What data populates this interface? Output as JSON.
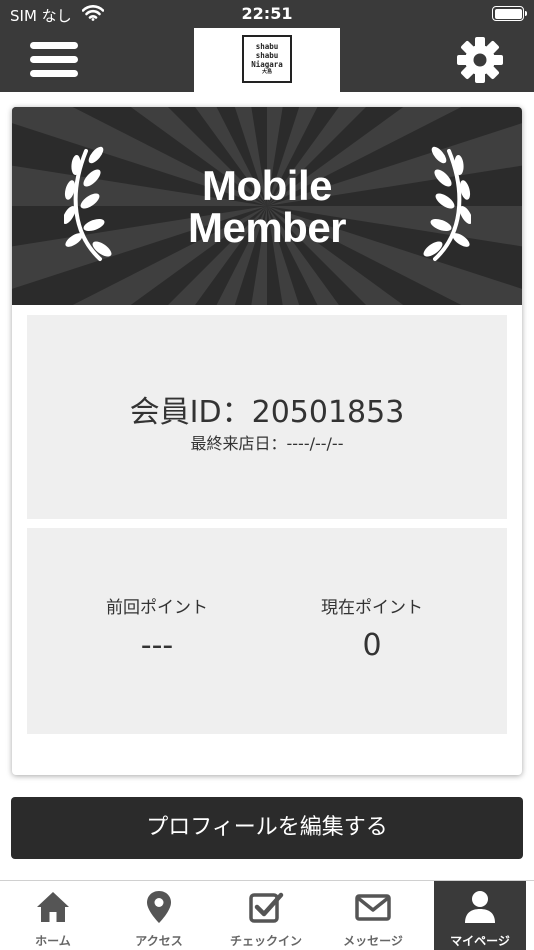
{
  "status_bar": {
    "carrier": "SIM なし",
    "time": "22:51"
  },
  "header": {
    "logo_lines": [
      "shabu",
      "shabu",
      "Niagara"
    ],
    "logo_sub": "大島",
    "icons": [
      "hamburger-menu-icon",
      "gear-icon"
    ]
  },
  "banner": {
    "title_line1": "Mobile",
    "title_line2": "Member"
  },
  "member": {
    "id_text": "会員ID：20501853",
    "last_visit": "最終来店日：----/--/--"
  },
  "points": {
    "previous_label": "前回ポイント",
    "previous_value": "---",
    "current_label": "現在ポイント",
    "current_value": "0"
  },
  "actions": {
    "edit_profile": "プロフィールを編集する"
  },
  "tabs": [
    {
      "label": "ホーム",
      "icon": "home-icon"
    },
    {
      "label": "アクセス",
      "icon": "map-pin-icon"
    },
    {
      "label": "チェックイン",
      "icon": "checkbox-icon"
    },
    {
      "label": "メッセージ",
      "icon": "envelope-icon"
    },
    {
      "label": "マイページ",
      "icon": "user-icon",
      "active": true
    }
  ],
  "colors": {
    "header_bg": "#3a3a3a",
    "banner_bg": "#2b2b2b",
    "panel_bg": "#efefef",
    "button_bg": "#2b2b2b",
    "active_tab_bg": "#3a3a3a"
  }
}
